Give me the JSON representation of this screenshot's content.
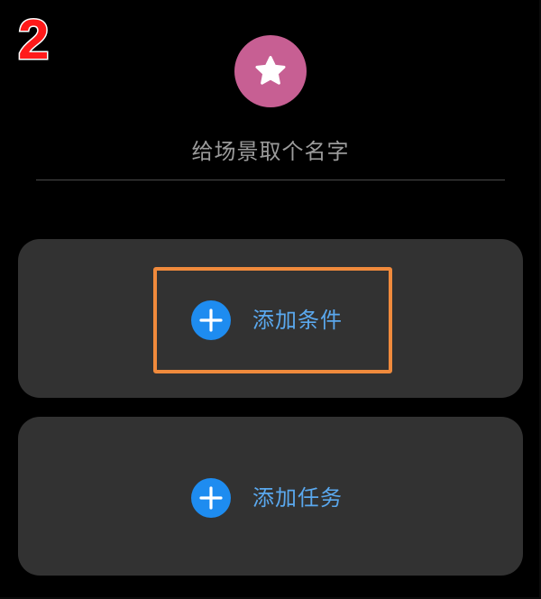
{
  "step": {
    "number": "2"
  },
  "header": {
    "icon": "star-icon",
    "icon_bg_color": "#c75f93",
    "name_placeholder": "给场景取个名字"
  },
  "condition_card": {
    "icon": "plus-icon",
    "label": "添加条件",
    "highlighted": true
  },
  "task_card": {
    "icon": "plus-icon",
    "label": "添加任务"
  },
  "colors": {
    "background": "#000000",
    "card": "#323232",
    "accent_blue": "#1e8cf0",
    "label_blue": "#5aa8ee",
    "highlight_orange": "#f08a3c",
    "step_red": "#ff1a1a",
    "placeholder_gray": "#9b9b9b"
  }
}
